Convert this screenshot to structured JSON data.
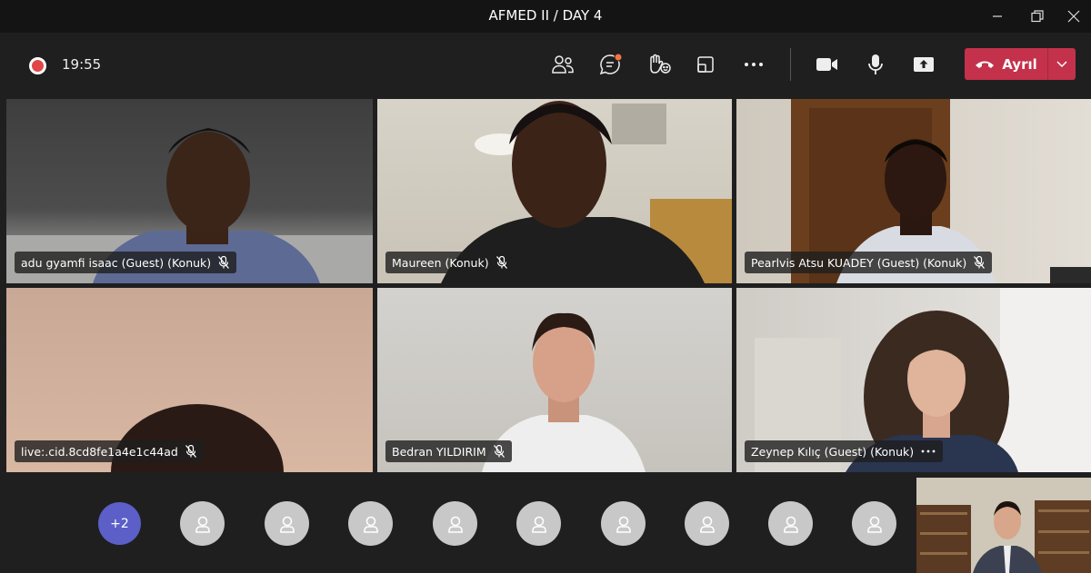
{
  "window": {
    "title": "AFMED II / DAY 4"
  },
  "toolbar": {
    "recording_time": "19:55",
    "leave_label": "Ayrıl"
  },
  "participants": [
    {
      "name": "adu gyamfi isaac (Guest) (Konuk)"
    },
    {
      "name": "Maureen (Konuk)"
    },
    {
      "name": "Pearlvis Atsu KUADEY (Guest) (Konuk)"
    },
    {
      "name": "live:.cid.8cd8fe1a4e1c44ad"
    },
    {
      "name": "Bedran YILDIRIM"
    },
    {
      "name": "Zeynep Kılıç (Guest) (Konuk)"
    }
  ],
  "gallery": {
    "overflow_count": "+2"
  },
  "colors": {
    "leave": "#c4314b",
    "overflow_badge": "#5b5fc7",
    "record": "#e04848"
  }
}
